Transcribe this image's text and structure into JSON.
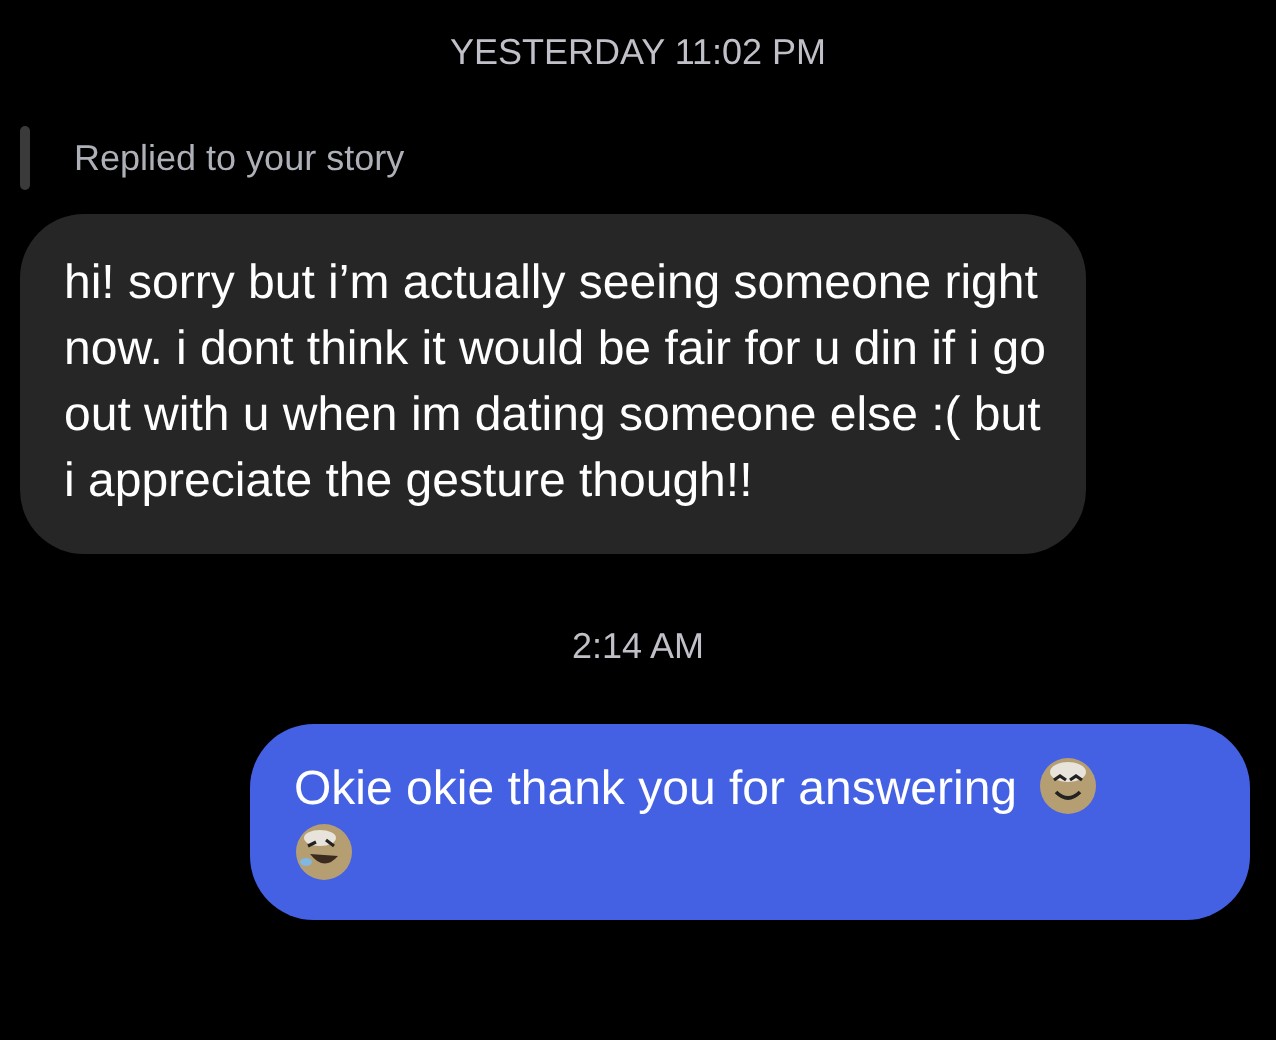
{
  "items": [
    {
      "kind": "timestamp",
      "text": "YESTERDAY 11:02 PM"
    },
    {
      "kind": "reply_note",
      "text": "Replied to your story"
    },
    {
      "kind": "received",
      "text": "hi! sorry but i’m actually seeing someone right now. i dont think it would be fair for u din if i go out with u when im dating someone else :( but i appreciate the gesture though!!"
    },
    {
      "kind": "timestamp",
      "text": "2:14 AM"
    },
    {
      "kind": "sent",
      "text": "Okie okie thank you for answering"
    }
  ]
}
